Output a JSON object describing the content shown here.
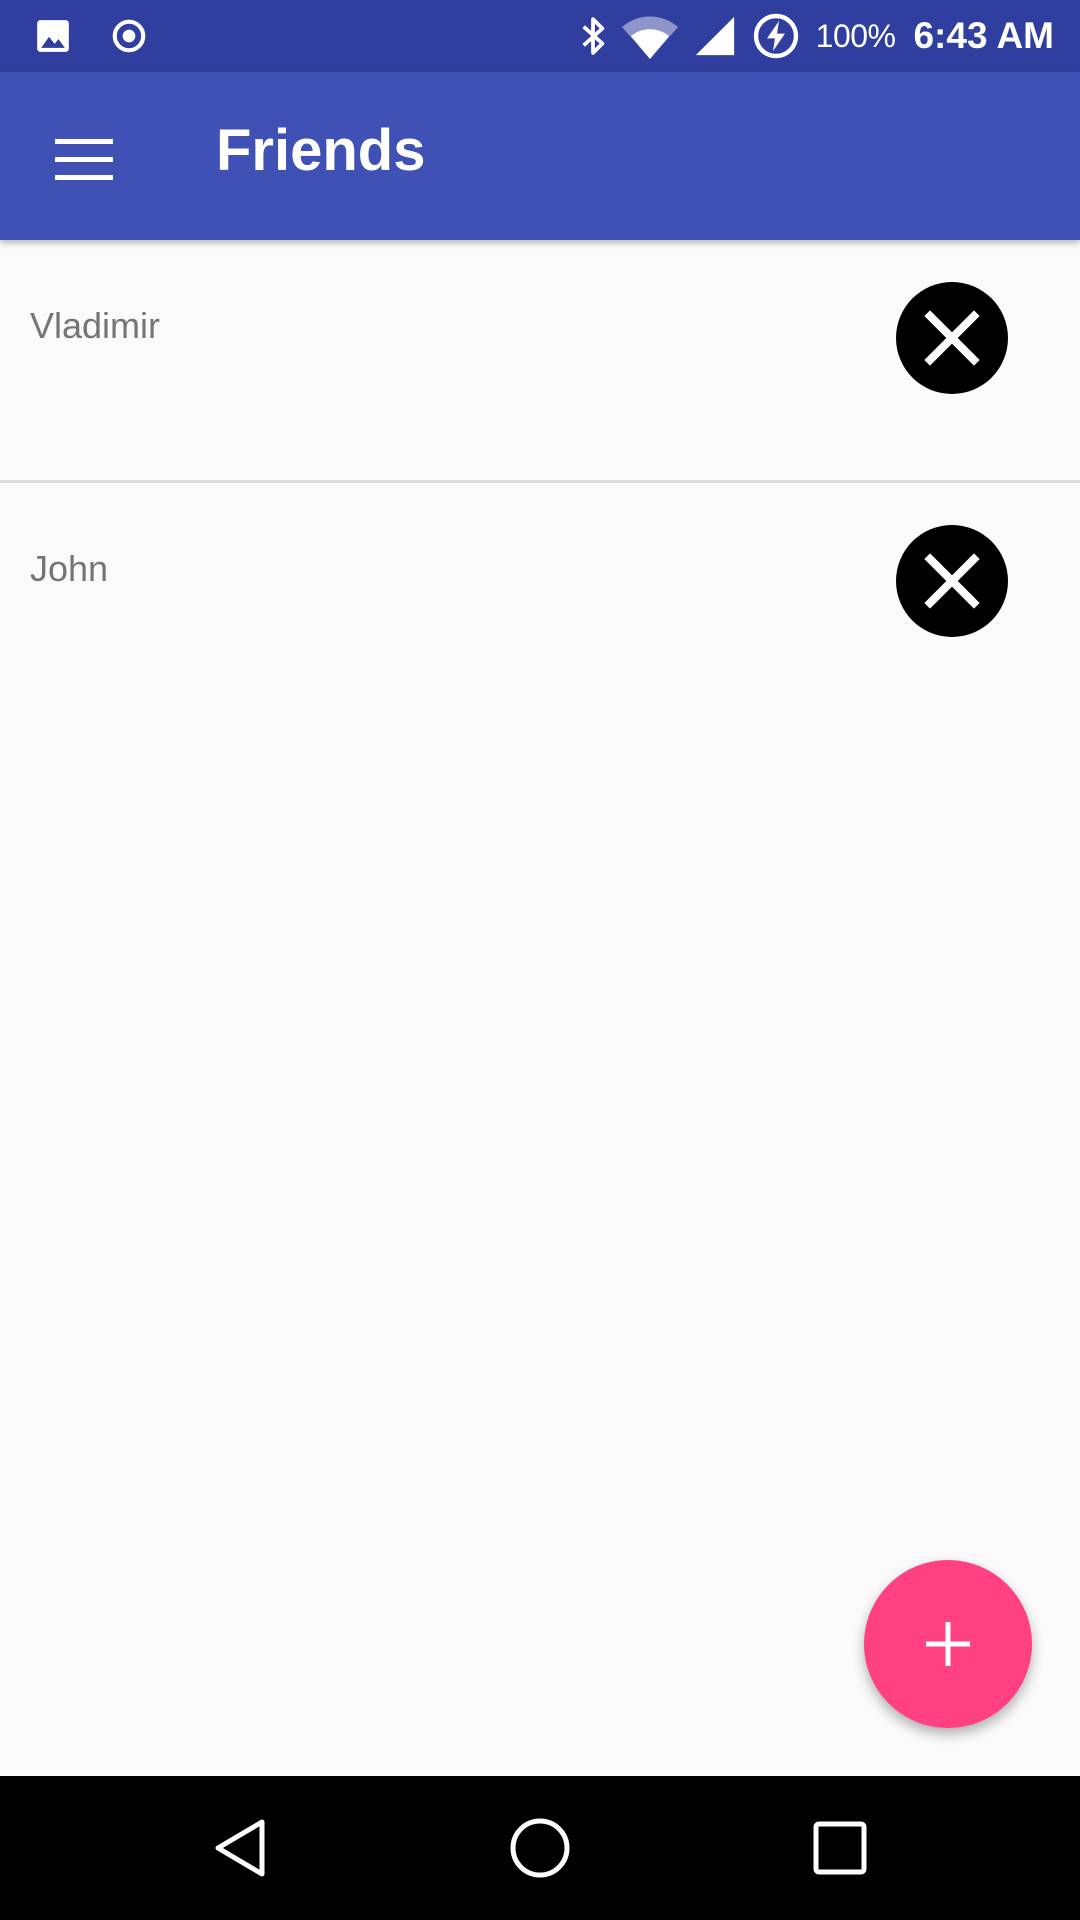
{
  "status_bar": {
    "notification_icons": [
      "image-icon",
      "record-icon"
    ],
    "system_icons": [
      "bluetooth-icon",
      "wifi-icon",
      "signal-icon",
      "battery-charging-icon"
    ],
    "battery_percent": "100%",
    "time": "6:43 AM"
  },
  "app_bar": {
    "title": "Friends",
    "menu_icon": "menu-icon"
  },
  "friends": [
    {
      "name": "Vladimir",
      "action_icon": "close-icon"
    },
    {
      "name": "John",
      "action_icon": "close-icon"
    }
  ],
  "fab": {
    "icon": "plus-icon"
  },
  "nav_bar": {
    "buttons": [
      "back-icon",
      "home-icon",
      "recents-icon"
    ]
  },
  "colors": {
    "status_bar": "#303F9F",
    "app_bar": "#3F51B5",
    "fab": "#FF4081",
    "background": "#FAFAFA",
    "list_text": "#757575"
  }
}
